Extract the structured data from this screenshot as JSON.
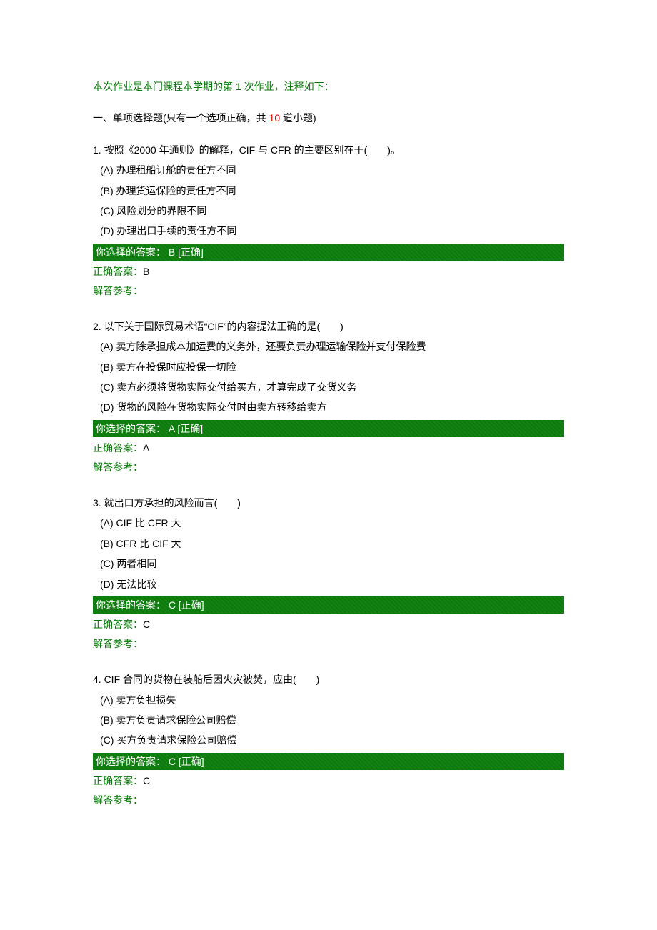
{
  "intro": {
    "prefix": "本次作业是本门课程本学期的第 ",
    "num": "1",
    "suffix": " 次作业，注释如下："
  },
  "section": {
    "prefix": "一、单项选择题(只有一个选项正确，共 ",
    "count": "10",
    "suffix": " 道小题)"
  },
  "labels": {
    "your_answer_prefix": "你选择的答案：",
    "correct_mark": "[正确]",
    "correct_answer_prefix": "正确答案：",
    "explain": "解答参考："
  },
  "questions": [
    {
      "stem": "1. 按照《2000 年通则》的解释，CIF 与 CFR 的主要区别在于(　　)。",
      "options": [
        "(A) 办理租船订舱的责任方不同",
        "(B) 办理货运保险的责任方不同",
        "(C) 风险划分的界限不同",
        "(D) 办理出口手续的责任方不同"
      ],
      "your_answer": " B ",
      "correct": "B"
    },
    {
      "stem": "2. 以下关于国际贸易术语“CIF”的内容提法正确的是(　　)",
      "options": [
        "(A) 卖方除承担成本加运费的义务外，还要负责办理运输保险并支付保险费",
        "(B) 卖方在投保时应投保一切险",
        "(C) 卖方必须将货物实际交付给买方，才算完成了交货义务",
        "(D) 货物的风险在货物实际交付时由卖方转移给卖方"
      ],
      "your_answer": " A ",
      "correct": "A"
    },
    {
      "stem": "3. 就出口方承担的风险而言(　　)",
      "options": [
        "(A) CIF 比 CFR 大",
        "(B) CFR 比 CIF 大",
        "(C) 两者相同",
        "(D) 无法比较"
      ],
      "your_answer": " C ",
      "correct": "C"
    },
    {
      "stem": "4. CIF 合同的货物在装船后因火灾被焚，应由(　　)",
      "options": [
        "(A) 卖方负担损失",
        "(B) 卖方负责请求保险公司赔偿",
        "(C) 买方负责请求保险公司赔偿"
      ],
      "your_answer": " C ",
      "correct": "C"
    }
  ]
}
